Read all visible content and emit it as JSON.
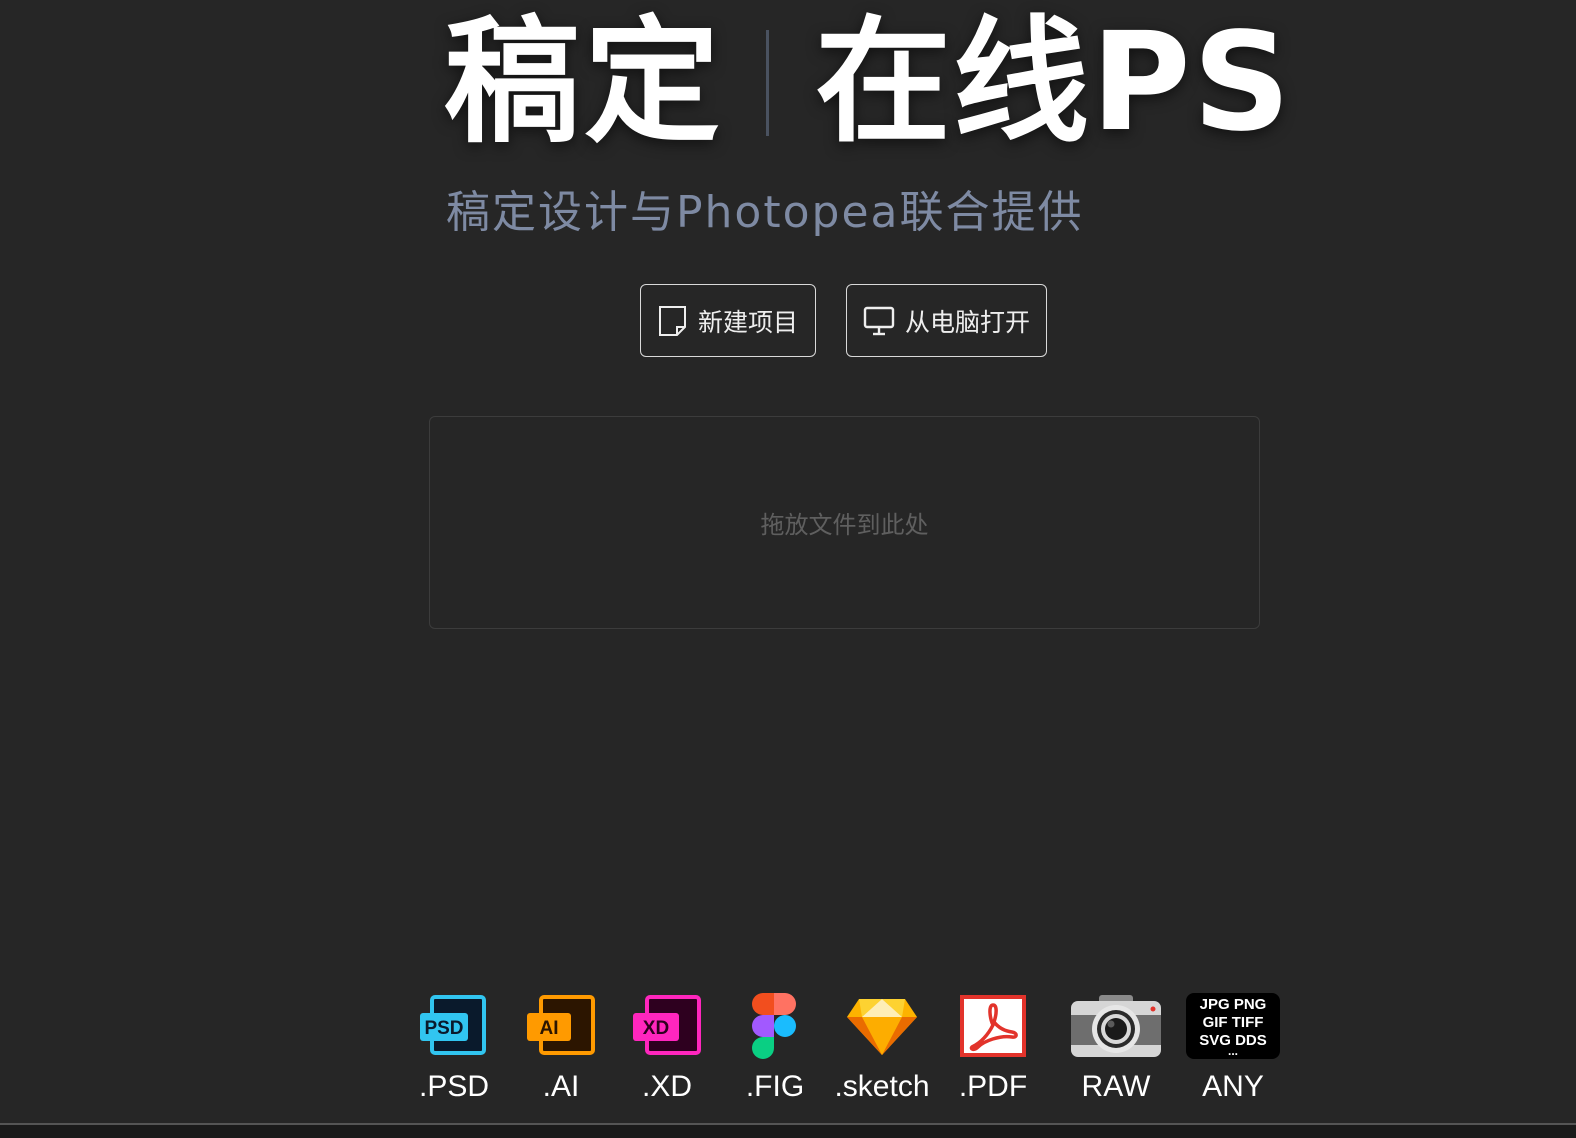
{
  "hero": {
    "brand": "稿定",
    "product": "在线PS",
    "subtitle": "稿定设计与Photopea联合提供"
  },
  "actions": {
    "new_project": {
      "label": "新建项目",
      "icon": "new-document-icon"
    },
    "open_from_computer": {
      "label": "从电脑打开",
      "icon": "monitor-icon"
    }
  },
  "dropzone": {
    "text": "拖放文件到此处"
  },
  "formats": [
    {
      "label": ".PSD",
      "icon": "psd-icon",
      "badge": "PSD",
      "color": "#31c5f0"
    },
    {
      "label": ".AI",
      "icon": "ai-icon",
      "badge": "AI",
      "color": "#ff9a00"
    },
    {
      "label": ".XD",
      "icon": "xd-icon",
      "badge": "XD",
      "color": "#ff26be"
    },
    {
      "label": ".FIG",
      "icon": "figma-icon"
    },
    {
      "label": ".sketch",
      "icon": "sketch-icon"
    },
    {
      "label": ".PDF",
      "icon": "pdf-icon"
    },
    {
      "label": "RAW",
      "icon": "camera-icon"
    },
    {
      "label": "ANY",
      "icon": "any-format-icon",
      "lines": [
        "JPG PNG",
        "GIF TIFF",
        "SVG DDS",
        "..."
      ]
    }
  ]
}
